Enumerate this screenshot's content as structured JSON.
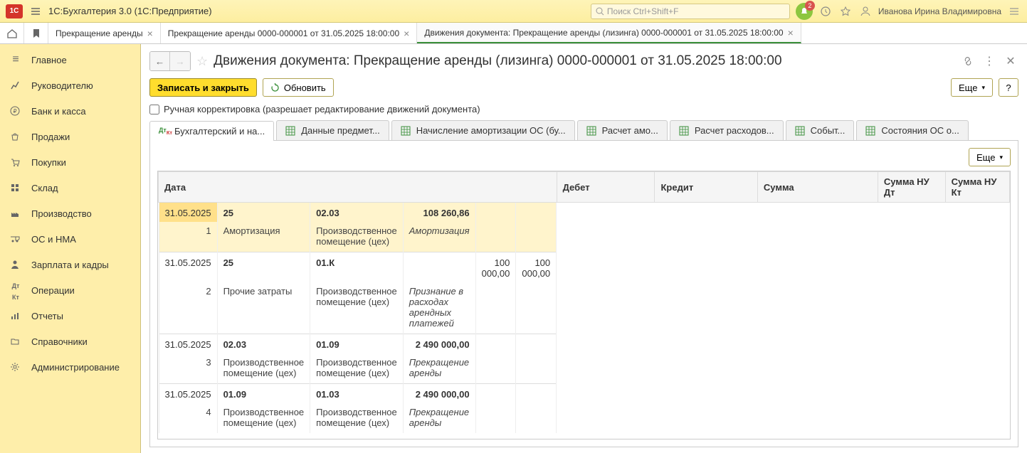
{
  "titlebar": {
    "app_title": "1С:Бухгалтерия 3.0  (1С:Предприятие)",
    "search_placeholder": "Поиск Ctrl+Shift+F",
    "notification_count": "2",
    "user_name": "Иванова Ирина Владимировна"
  },
  "tabs": [
    {
      "label": "Прекращение аренды",
      "active": false
    },
    {
      "label": "Прекращение аренды 0000-000001 от 31.05.2025 18:00:00",
      "active": false
    },
    {
      "label": "Движения документа: Прекращение аренды (лизинга) 0000-000001 от 31.05.2025 18:00:00",
      "active": true
    }
  ],
  "sidebar": [
    {
      "icon": "≡",
      "label": "Главное"
    },
    {
      "icon": "chart",
      "label": "Руководителю"
    },
    {
      "icon": "ruble",
      "label": "Банк и касса"
    },
    {
      "icon": "bag",
      "label": "Продажи"
    },
    {
      "icon": "cart",
      "label": "Покупки"
    },
    {
      "icon": "boxes",
      "label": "Склад"
    },
    {
      "icon": "factory",
      "label": "Производство"
    },
    {
      "icon": "truck",
      "label": "ОС и НМА"
    },
    {
      "icon": "person",
      "label": "Зарплата и кадры"
    },
    {
      "icon": "dk",
      "label": "Операции"
    },
    {
      "icon": "bars",
      "label": "Отчеты"
    },
    {
      "icon": "folder",
      "label": "Справочники"
    },
    {
      "icon": "gear",
      "label": "Администрирование"
    }
  ],
  "page": {
    "title": "Движения документа: Прекращение аренды (лизинга) 0000-000001 от 31.05.2025 18:00:00",
    "write_close": "Записать и закрыть",
    "refresh": "Обновить",
    "more": "Еще",
    "help": "?",
    "manual_edit": "Ручная корректировка (разрешает редактирование движений документа)"
  },
  "subtabs": [
    {
      "label": "Бухгалтерский и на...",
      "icon": "dk",
      "active": true
    },
    {
      "label": "Данные предмет...",
      "icon": "grid",
      "active": false
    },
    {
      "label": "Начисление амортизации ОС (бу...",
      "icon": "grid",
      "active": false
    },
    {
      "label": "Расчет амо...",
      "icon": "grid",
      "active": false
    },
    {
      "label": "Расчет расходов...",
      "icon": "grid",
      "active": false
    },
    {
      "label": "Событ...",
      "icon": "grid",
      "active": false
    },
    {
      "label": "Состояния ОС о...",
      "icon": "grid",
      "active": false
    }
  ],
  "grid": {
    "headers": {
      "date": "Дата",
      "debit": "Дебет",
      "credit": "Кредит",
      "sum": "Сумма",
      "nu_dt": "Сумма НУ Дт",
      "nu_kt": "Сумма НУ Кт"
    },
    "rows": [
      {
        "date": "31.05.2025",
        "n": "1",
        "debit_acc": "25",
        "debit_sub": "Амортизация",
        "credit_acc": "02.03",
        "credit_sub": "Производственное помещение (цех)",
        "sum": "108 260,86",
        "sum_note": "Амортизация",
        "nu_dt": "",
        "nu_kt": "",
        "selected": true
      },
      {
        "date": "31.05.2025",
        "n": "2",
        "debit_acc": "25",
        "debit_sub": "Прочие затраты",
        "credit_acc": "01.К",
        "credit_sub": "Производственное помещение (цех)",
        "sum": "",
        "sum_note": "Признание в расходах арендных платежей",
        "nu_dt": "100 000,00",
        "nu_kt": "100 000,00",
        "selected": false
      },
      {
        "date": "31.05.2025",
        "n": "3",
        "debit_acc": "02.03",
        "debit_sub": "Производственное помещение (цех)",
        "credit_acc": "01.09",
        "credit_sub": "Производственное помещение (цех)",
        "sum": "2 490 000,00",
        "sum_note": "Прекращение аренды",
        "nu_dt": "",
        "nu_kt": "",
        "selected": false
      },
      {
        "date": "31.05.2025",
        "n": "4",
        "debit_acc": "01.09",
        "debit_sub": "Производственное помещение (цех)",
        "credit_acc": "01.03",
        "credit_sub": "Производственное помещение (цех)",
        "sum": "2 490 000,00",
        "sum_note": "Прекращение аренды",
        "nu_dt": "",
        "nu_kt": "",
        "selected": false
      }
    ]
  }
}
